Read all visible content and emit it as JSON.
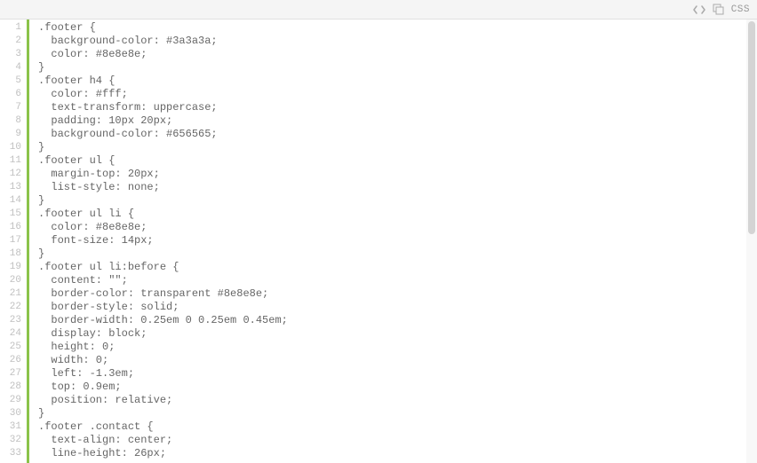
{
  "topbar": {
    "lang_label": "CSS"
  },
  "code": {
    "lines": [
      ".footer {",
      "  background-color: #3a3a3a;",
      "  color: #8e8e8e;",
      "}",
      ".footer h4 {",
      "  color: #fff;",
      "  text-transform: uppercase;",
      "  padding: 10px 20px;",
      "  background-color: #656565;",
      "}",
      ".footer ul {",
      "  margin-top: 20px;",
      "  list-style: none;",
      "}",
      ".footer ul li {",
      "  color: #8e8e8e;",
      "  font-size: 14px;",
      "}",
      ".footer ul li:before {",
      "  content: \"\";",
      "  border-color: transparent #8e8e8e;",
      "  border-style: solid;",
      "  border-width: 0.25em 0 0.25em 0.45em;",
      "  display: block;",
      "  height: 0;",
      "  width: 0;",
      "  left: -1.3em;",
      "  top: 0.9em;",
      "  position: relative;",
      "}",
      ".footer .contact {",
      "  text-align: center;",
      "  line-height: 26px;"
    ]
  }
}
